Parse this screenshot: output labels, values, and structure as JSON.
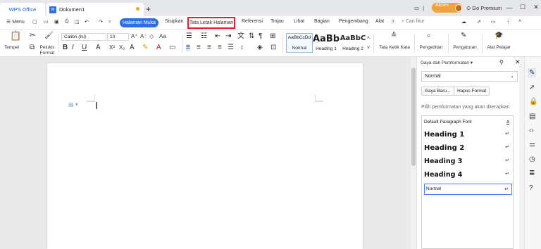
{
  "titlebar": {
    "app_tab": "WPS Office",
    "doc_tab": "Dokumen1",
    "doc_icon": "W",
    "new_tab": "+",
    "user_name": "Akses ...",
    "premium": "Go Premium"
  },
  "menu": {
    "menu_label": "Menu",
    "tabs": [
      "Halaman Muka",
      "Sisipkan",
      "Tata Letak Halaman",
      "Referensi",
      "Tinjau",
      "Lihat",
      "Bagian",
      "Pengembang",
      "Alat"
    ],
    "search_placeholder": "Cari fitur"
  },
  "ribbon": {
    "paste_label": "Tempel",
    "format_painter_label": "Pelukis Format",
    "font_name": "Calibri (Isi)",
    "font_size": "10",
    "styles": [
      {
        "preview": "AaBbCcDd",
        "name": "Normal"
      },
      {
        "preview": "AaBb",
        "name": "Heading 1"
      },
      {
        "preview": "AaBbC",
        "name": "Heading 2"
      }
    ],
    "text_direction_label": "Tata Ketik Kata",
    "find_label": "Pengeditan",
    "settings_label": "Pengaturan",
    "tools_label": "Alat Pelajar"
  },
  "panel": {
    "title": "Gaya dan Pemformatan",
    "current_style": "Normal",
    "new_style_btn": "Gaya Baru...",
    "clear_format_btn": "Hapus Format",
    "hint": "Pilih pemformatan yang akan diterapkan",
    "styles": [
      {
        "name": "Default Paragraph Font",
        "mark": "a"
      },
      {
        "name": "Heading 1",
        "mark": "↵"
      },
      {
        "name": "Heading 2",
        "mark": "↵"
      },
      {
        "name": "Heading 3",
        "mark": "↵"
      },
      {
        "name": "Heading 4",
        "mark": "↵"
      },
      {
        "name": "Normal",
        "mark": "↵"
      }
    ]
  },
  "colors": {
    "accent": "#2d6fe3",
    "highlight_border": "#e0222a",
    "user_pill": "#f1a23a"
  }
}
